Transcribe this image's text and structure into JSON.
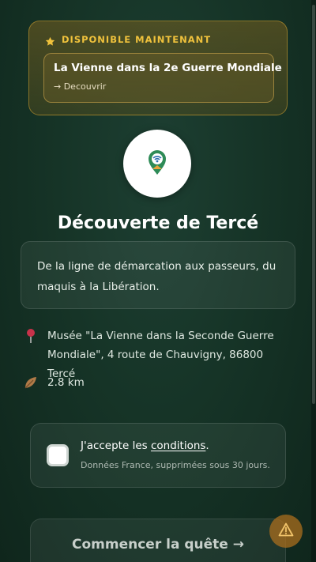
{
  "available": {
    "header": "DISPONIBLE MAINTENANT",
    "item_title": "La Vienne dans la 2e Guerre Mondiale",
    "item_link": "→ Decouvrir"
  },
  "quest": {
    "title": "Découverte de Tercé",
    "description": "De la ligne de démarcation aux passeurs, du maquis à la Libération.",
    "address": "Musée \"La Vienne dans la Seconde Guerre Mondiale\", 4 route de Chauvigny, 86800 Tercé",
    "distance": "2.8 km"
  },
  "consent": {
    "prefix": "J'accepte les ",
    "link": "conditions",
    "suffix": ".",
    "note": "Données France, supprimées sous 30 jours.",
    "checked": false
  },
  "actions": {
    "start_label": "Commencer la quête →"
  },
  "icons": {
    "star": "star-icon",
    "logo": "map-pin-logo-icon",
    "location": "pushpin-icon",
    "distance": "leaf-icon",
    "warning": "warning-icon"
  },
  "colors": {
    "accent_gold": "#f0c23c",
    "background": "#163427",
    "warning": "#a86e1e"
  }
}
